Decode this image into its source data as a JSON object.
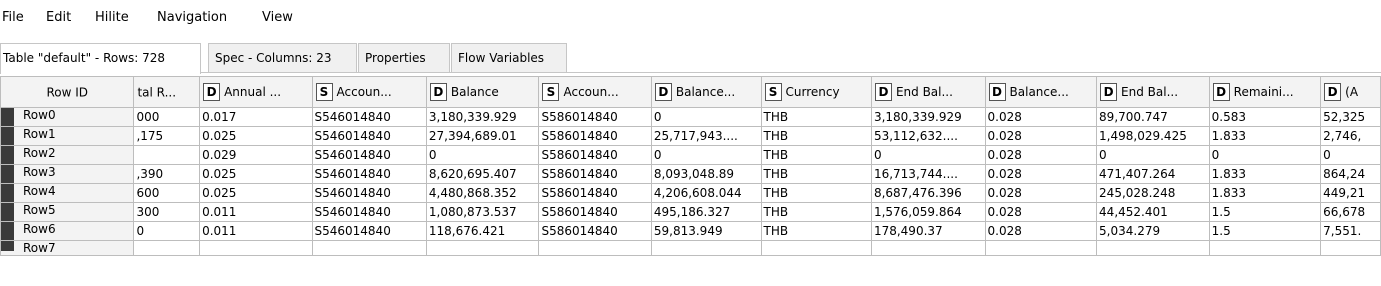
{
  "menu": [
    "File",
    "Edit",
    "Hilite",
    "Navigation",
    "View"
  ],
  "tabs": [
    {
      "label": "Table \"default\" - Rows: 728"
    },
    {
      "label": "Spec - Columns: 23"
    },
    {
      "label": "Properties"
    },
    {
      "label": "Flow Variables"
    }
  ],
  "table": {
    "headers": [
      {
        "type": "",
        "label": "Row ID"
      },
      {
        "type": "",
        "label": "tal R..."
      },
      {
        "type": "D",
        "label": "Annual ..."
      },
      {
        "type": "S",
        "label": "Accoun..."
      },
      {
        "type": "D",
        "label": "Balance"
      },
      {
        "type": "S",
        "label": "Accoun..."
      },
      {
        "type": "D",
        "label": "Balance..."
      },
      {
        "type": "S",
        "label": "Currency"
      },
      {
        "type": "D",
        "label": "End Bal..."
      },
      {
        "type": "D",
        "label": "Balance..."
      },
      {
        "type": "D",
        "label": "End Bal..."
      },
      {
        "type": "D",
        "label": "Remaini..."
      },
      {
        "type": "D",
        "label": "(A"
      }
    ],
    "rows": [
      [
        "Row0",
        "000",
        "0.017",
        "S546014840",
        "3,180,339.929",
        "S586014840",
        "0",
        "THB",
        "3,180,339.929",
        "0.028",
        "89,700.747",
        "0.583",
        "52,325"
      ],
      [
        "Row1",
        ",175",
        "0.025",
        "S546014840",
        "27,394,689.01",
        "S586014840",
        "25,717,943....",
        "THB",
        "53,112,632....",
        "0.028",
        "1,498,029.425",
        "1.833",
        "2,746,"
      ],
      [
        "Row2",
        "",
        "0.029",
        "S546014840",
        "0",
        "S586014840",
        "0",
        "THB",
        "0",
        "0.028",
        "0",
        "0",
        "0"
      ],
      [
        "Row3",
        ",390",
        "0.025",
        "S546014840",
        "8,620,695.407",
        "S586014840",
        "8,093,048.89",
        "THB",
        "16,713,744....",
        "0.028",
        "471,407.264",
        "1.833",
        "864,24"
      ],
      [
        "Row4",
        "600",
        "0.025",
        "S546014840",
        "4,480,868.352",
        "S586014840",
        "4,206,608.044",
        "THB",
        "8,687,476.396",
        "0.028",
        "245,028.248",
        "1.833",
        "449,21"
      ],
      [
        "Row5",
        "300",
        "0.011",
        "S546014840",
        "1,080,873.537",
        "S586014840",
        "495,186.327",
        "THB",
        "1,576,059.864",
        "0.028",
        "44,452.401",
        "1.5",
        "66,678"
      ],
      [
        "Row6",
        "0",
        "0.011",
        "S546014840",
        "118,676.421",
        "S586014840",
        "59,813.949",
        "THB",
        "178,490.37",
        "0.028",
        "5,034.279",
        "1.5",
        "7,551."
      ]
    ],
    "partial_row_id": "Row7"
  }
}
